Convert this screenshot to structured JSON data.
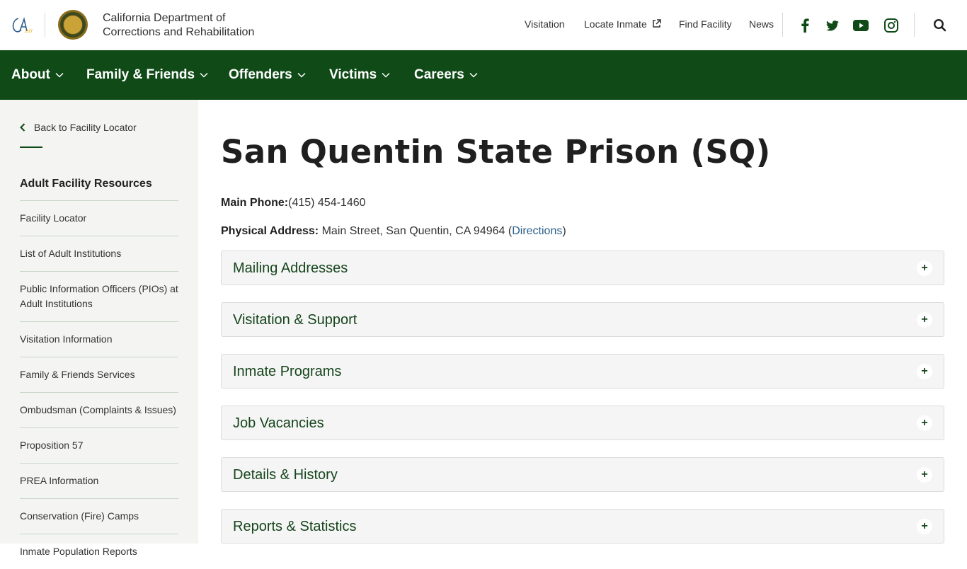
{
  "header": {
    "ca_logo_text": "CA.GOV",
    "dept_name_line1": "California Department of",
    "dept_name_line2": "Corrections and Rehabilitation",
    "top_links": [
      "Visitation",
      "Locate Inmate",
      "Find Facility",
      "News"
    ],
    "social_icons": [
      "facebook-icon",
      "twitter-icon",
      "youtube-icon",
      "instagram-icon"
    ],
    "search_icon": "search-icon"
  },
  "main_nav": {
    "items": [
      "About",
      "Family & Friends",
      "Offenders",
      "Victims",
      "Careers"
    ]
  },
  "sidebar": {
    "back_label": "Back to Facility Locator",
    "heading": "Adult Facility Resources",
    "items": [
      "Facility Locator",
      "List of Adult Institutions",
      "Public Information Officers (PIOs) at Adult Institutions",
      "Visitation Information",
      "Family & Friends Services",
      "Ombudsman (Complaints & Issues)",
      "Proposition 57",
      "PREA Information",
      "Conservation (Fire) Camps",
      "Inmate Population Reports"
    ]
  },
  "main": {
    "title": "San Quentin State Prison (SQ)",
    "phone_label": "Main Phone:",
    "phone_value": "(415) 454-1460",
    "address_label": "Physical Address:",
    "address_value": "Main Street, San Quentin, CA 94964 (",
    "directions_link": "Directions",
    "address_close": ")",
    "accordions": [
      "Mailing Addresses",
      "Visitation & Support",
      "Inmate Programs",
      "Job Vacancies",
      "Details & History",
      "Reports & Statistics"
    ],
    "accordion_toggle": "+"
  },
  "colors": {
    "nav_green": "#0f4a17",
    "accordion_text": "#16451c",
    "link_blue": "#2b5f8a",
    "sidebar_bg": "#f4f4f2"
  }
}
